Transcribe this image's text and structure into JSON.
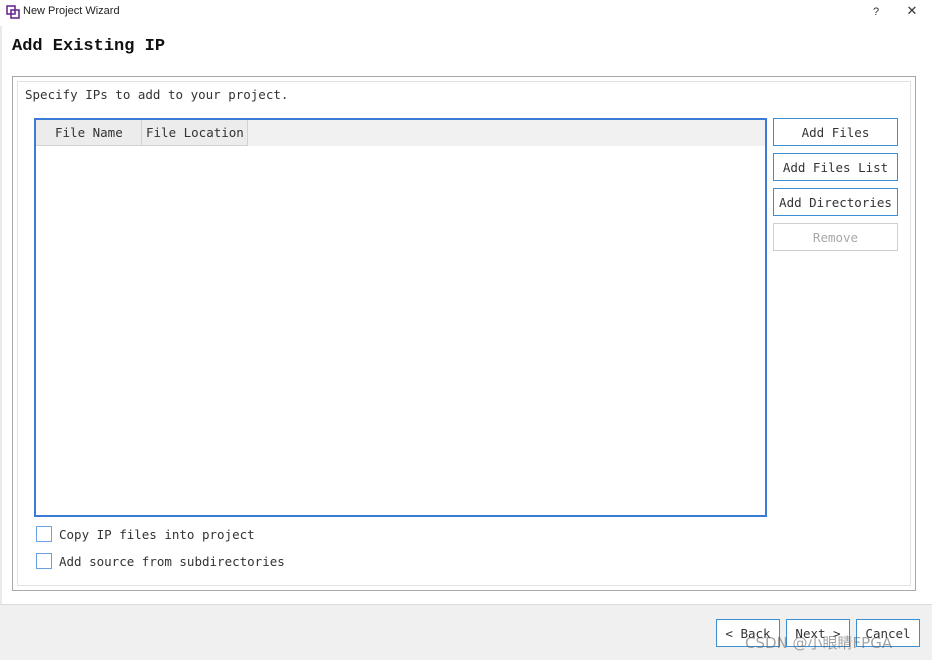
{
  "window": {
    "title": "New Project Wizard",
    "help_label": "?",
    "close_label": "✕"
  },
  "page": {
    "title": "Add Existing IP",
    "instruction": "Specify IPs to add to your project."
  },
  "table": {
    "columns": [
      "File Name",
      "File Location"
    ],
    "rows": []
  },
  "side_buttons": {
    "add_files": "Add Files",
    "add_files_list": "Add Files List",
    "add_directories": "Add Directories",
    "remove": "Remove"
  },
  "options": {
    "copy_ip": {
      "label": "Copy IP files into project",
      "checked": false
    },
    "add_subdirs": {
      "label": "Add source from subdirectories",
      "checked": false
    }
  },
  "nav": {
    "back": "< Back",
    "next": "Next >",
    "cancel": "Cancel"
  },
  "watermark": "CSDN @小眼睛FPGA",
  "colors": {
    "accent": "#3a7bd5",
    "disabled_text": "#a8a8a8",
    "footer_bg": "#f0f0f0"
  }
}
